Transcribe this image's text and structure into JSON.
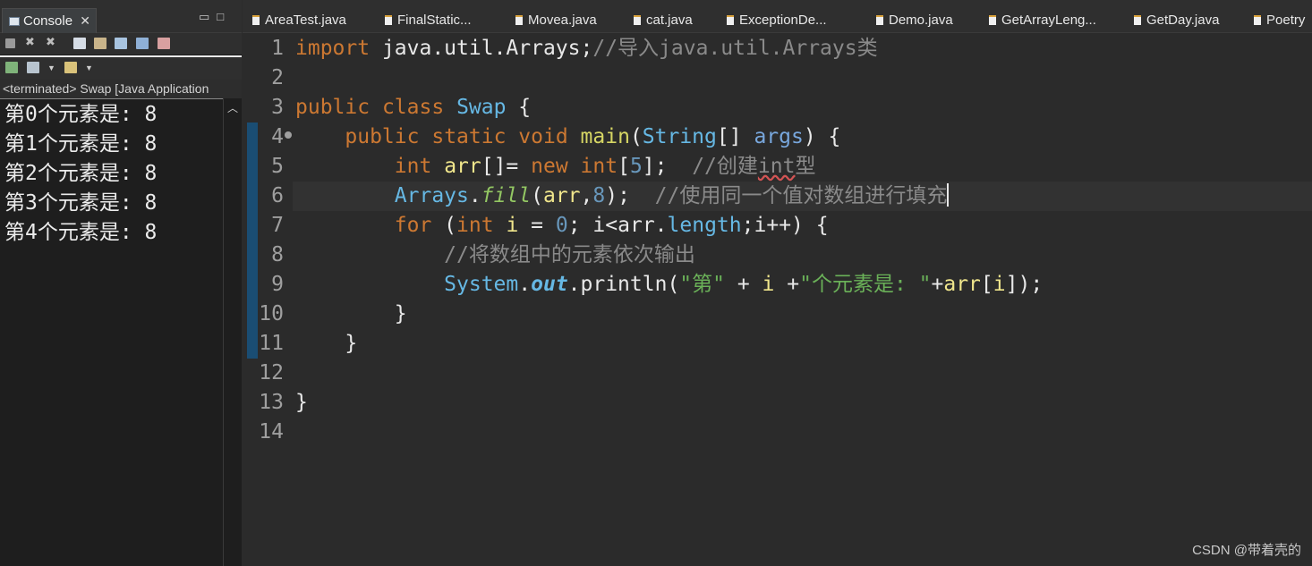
{
  "console": {
    "tab_label": "Console",
    "status": "<terminated> Swap [Java Application",
    "output": [
      "第0个元素是: 8",
      "第1个元素是: 8",
      "第2个元素是: 8",
      "第3个元素是: 8",
      "第4个元素是: 8"
    ]
  },
  "editor": {
    "tabs": [
      "AreaTest.java",
      "FinalStatic...",
      "Movea.java",
      "cat.java",
      "ExceptionDe...",
      "Demo.java",
      "GetArrayLeng...",
      "GetDay.java",
      "Poetry"
    ],
    "line_numbers": [
      "1",
      "2",
      "3",
      "4",
      "5",
      "6",
      "7",
      "8",
      "9",
      "10",
      "11",
      "12",
      "13",
      "14"
    ],
    "code": {
      "l1": {
        "kw": "import",
        "rest": " java.util.Arrays;",
        "comment": "//导入java.util.Arrays类"
      },
      "l3": {
        "kw1": "public",
        "kw2": "class",
        "name": "Swap",
        "brace": " {"
      },
      "l4": {
        "kw1": "public",
        "kw2": "static",
        "kw3": "void",
        "method": "main",
        "open": "(",
        "type": "String",
        "arr": "[]",
        "param": "args",
        "close": ") {"
      },
      "l5": {
        "kw1": "int",
        "var": "arr",
        "op": "[]= ",
        "kw2": "new",
        "kw3": "int",
        "open": "[",
        "num": "5",
        "close": "];",
        "comment": "//创建",
        "comment_err": "int",
        "comment_end": "型"
      },
      "l6": {
        "cls": "Arrays",
        "dot": ".",
        "method": "fill",
        "open": "(",
        "var": "arr",
        "comma": ",",
        "num": "8",
        "close": ");",
        "comment": "//使用同一个值对数组进行填充"
      },
      "l7": {
        "kw1": "for",
        "open": " (",
        "kw2": "int",
        "var1": "i",
        "eq": " = ",
        "num": "0",
        "semi": "; ",
        "var2": "i",
        "lt": "<",
        "var3": "arr",
        "dot": ".",
        "field": "length",
        "semi2": ";",
        "var4": "i",
        "inc": "++) {"
      },
      "l8": {
        "comment": "//将数组中的元素依次输出"
      },
      "l9": {
        "cls": "System",
        "dot": ".",
        "field": "out",
        "call": ".println(",
        "str1": "\"第\"",
        "plus1": " + ",
        "var": "i",
        "plus2": " +",
        "str2": "\"个元素是: \"",
        "plus3": "+",
        "arr": "arr",
        "idx_open": "[",
        "idx": "i",
        "end": "]);"
      },
      "l10": {
        "brace": "}"
      },
      "l11": {
        "brace": "}"
      },
      "l13": {
        "brace": "}"
      }
    }
  },
  "watermark": "CSDN @带着壳的"
}
